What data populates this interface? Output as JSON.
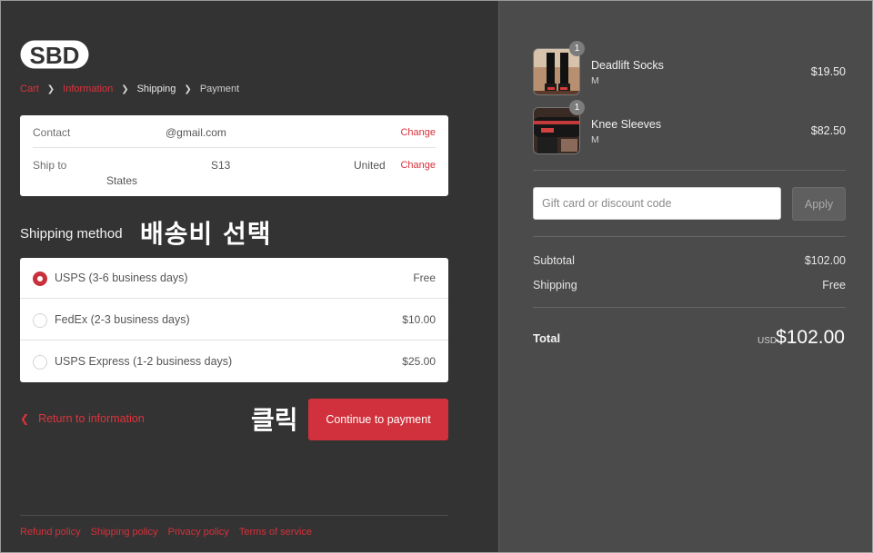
{
  "brand": {
    "logo_text": "SBD"
  },
  "breadcrumb": [
    {
      "label": "Cart"
    },
    {
      "label": "Information"
    },
    {
      "label": "Shipping"
    },
    {
      "label": "Payment"
    }
  ],
  "review": {
    "contact_label": "Contact",
    "contact_value": "@gmail.com",
    "ship_label": "Ship to",
    "ship_value_a": "S13",
    "ship_value_b": "United",
    "ship_value_c": "States",
    "change_label": "Change"
  },
  "shipping": {
    "title": "Shipping method",
    "annotation": "배송비 선택",
    "options": [
      {
        "label": "USPS (3-6 business days)",
        "price": "Free",
        "selected": true
      },
      {
        "label": "FedEx (2-3 business days)",
        "price": "$10.00",
        "selected": false
      },
      {
        "label": "USPS Express (1-2 business days)",
        "price": "$25.00",
        "selected": false
      }
    ]
  },
  "actions": {
    "return_label": "Return to information",
    "continue_label": "Continue to payment",
    "annotation": "클릭"
  },
  "footer": {
    "links": [
      "Refund policy",
      "Shipping policy",
      "Privacy policy",
      "Terms of service"
    ]
  },
  "summary": {
    "items": [
      {
        "name": "Deadlift Socks",
        "variant": "M",
        "price": "$19.50",
        "qty": "1"
      },
      {
        "name": "Knee Sleeves",
        "variant": "M",
        "price": "$82.50",
        "qty": "1"
      }
    ],
    "discount_placeholder": "Gift card or discount code",
    "apply_label": "Apply",
    "subtotal_label": "Subtotal",
    "subtotal_value": "$102.00",
    "shipping_label": "Shipping",
    "shipping_value": "Free",
    "total_label": "Total",
    "currency": "USD",
    "total_value": "$102.00"
  },
  "colors": {
    "accent": "#d0313c",
    "left_bg": "#333333",
    "right_bg": "#4b4b4b"
  }
}
